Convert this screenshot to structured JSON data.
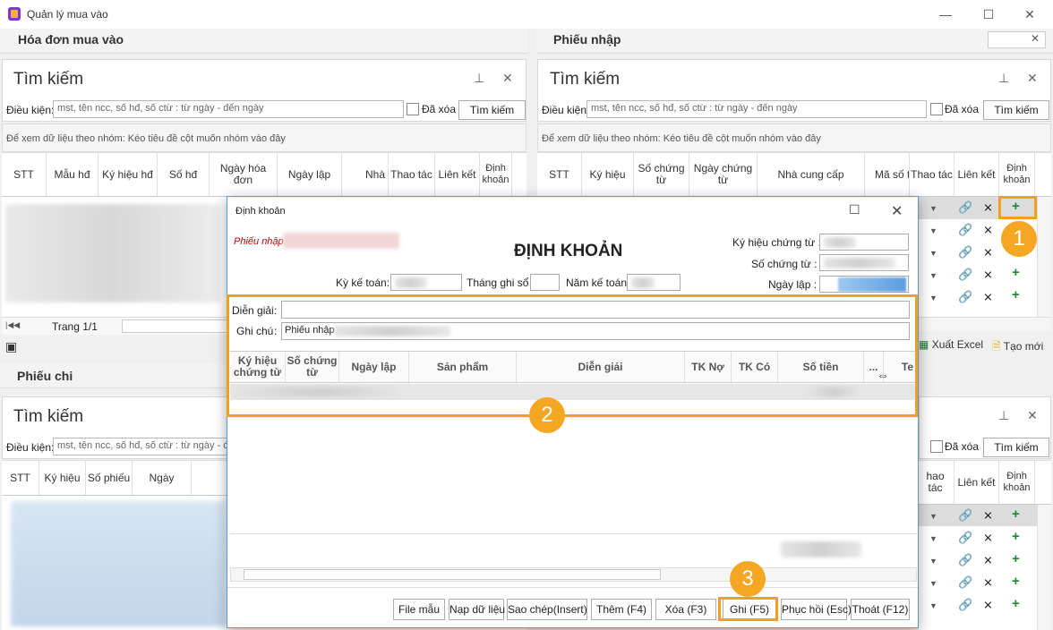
{
  "window": {
    "title": "Quản lý mua vào"
  },
  "left_top": {
    "section_title": "Hóa đơn mua vào",
    "search_title": "Tìm kiếm",
    "cond_label": "Điều kiện:",
    "cond_placeholder": "mst, tên ncc, số hđ, số ctừ : từ ngày - đến ngày",
    "deleted_label": "Đã xóa",
    "search_button": "Tìm kiếm",
    "group_hint": "Để xem dữ liệu theo nhóm: Kéo tiêu đề cột muốn nhóm vào đây",
    "columns": [
      "STT",
      "Mẫu hđ",
      "Ký hiệu hđ",
      "Số hđ",
      "Ngày hóa đơn",
      "Ngày lập",
      "Nhà",
      "Thao tác",
      "Liên kết",
      "Định khoản"
    ],
    "page_label": "Trang 1/1"
  },
  "right_top": {
    "section_title": "Phiếu nhập",
    "search_title": "Tìm kiếm",
    "cond_label": "Điều kiện:",
    "cond_placeholder": "mst, tên ncc, số hđ, số ctừ : từ ngày - đến ngày",
    "deleted_label": "Đã xóa",
    "search_button": "Tìm kiếm",
    "group_hint": "Để xem dữ liệu theo nhóm: Kéo tiêu đề cột muốn nhóm vào đây",
    "columns": [
      "STT",
      "Ký hiệu",
      "Số chứng từ",
      "Ngày chứng từ",
      "Nhà cung cấp",
      "Mã số th",
      "Thao tác",
      "Liên kết",
      "Định khoản"
    ],
    "export_excel": "Xuất Excel",
    "new_button": "Tạo mới"
  },
  "left_bottom": {
    "section_title": "Phiếu chi",
    "search_title": "Tìm kiếm",
    "cond_label": "Điều kiện:",
    "cond_placeholder": "mst, tên ncc, số hđ, số ctừ : từ ngày - đến ngày",
    "columns": [
      "STT",
      "Ký hiệu",
      "Số phiếu",
      "Ngày"
    ]
  },
  "right_bottom": {
    "deleted_label": "Đã xóa",
    "search_button": "Tìm kiếm",
    "columns": [
      "hao tác",
      "Liên kết",
      "Định khoản"
    ]
  },
  "dialog": {
    "title": "Định khoản",
    "doc_type": "Phiếu nhập",
    "heading": "ĐỊNH KHOẢN",
    "ky_hieu_label": "Ký hiệu chứng từ :",
    "so_ct_label": "Số chứng từ :",
    "ngay_lap_label": "Ngày lập :",
    "ky_ke_toan_label": "Kỳ kế toán:",
    "thang_label": "Tháng ghi sổ :",
    "nam_label": "Năm kế toán :",
    "dien_giai_label": "Diễn giải",
    "ghi_chu_label": "Ghi chú",
    "ghi_chu_value": "Phiếu nhập",
    "grid_columns": [
      "Ký hiệu chứng từ",
      "Số chứng từ",
      "Ngày lập",
      "Sản phẩm",
      "Diễn giải",
      "TK Nợ",
      "TK Có",
      "Số tiền",
      "...",
      "Te"
    ],
    "buttons": {
      "file_mau": "File mẫu",
      "nap": "Nạp dữ liệu",
      "sao_chep": "Sao chép(Insert)",
      "them": "Thêm (F4)",
      "xoa": "Xóa (F3)",
      "ghi": "Ghi (F5)",
      "phuc_hoi": "Phục hồi (Esc)",
      "thoat": "Thoát (F12)"
    }
  },
  "callouts": [
    "1",
    "2",
    "3"
  ],
  "colors": {
    "callout": "#f5a623",
    "plus": "#1a8a2a",
    "dialog_border": "#5b9bd5"
  }
}
